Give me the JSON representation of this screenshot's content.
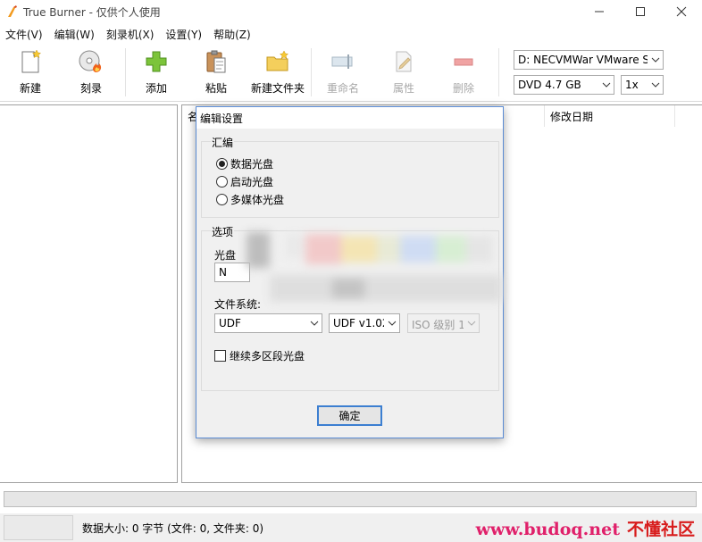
{
  "window": {
    "title": "True Burner - 仅供个人使用"
  },
  "menu": [
    {
      "label": "文件(V)"
    },
    {
      "label": "编辑(W)"
    },
    {
      "label": "刻录机(X)"
    },
    {
      "label": "设置(Y)"
    },
    {
      "label": "帮助(Z)"
    }
  ],
  "toolbar": {
    "new_label": "新建",
    "burn_label": "刻录",
    "add_label": "添加",
    "paste_label": "粘贴",
    "new_folder_label": "新建文件夹",
    "rename_label": "重命名",
    "properties_label": "属性",
    "delete_label": "删除"
  },
  "drive": {
    "value": "D: NECVMWar VMware S"
  },
  "disc_type": {
    "value": "DVD 4.7 GB"
  },
  "speed": {
    "value": "1x"
  },
  "file_list": {
    "columns": [
      "名",
      "修改日期"
    ]
  },
  "dialog": {
    "title": "编辑设置",
    "compile_group": "汇编",
    "options": [
      {
        "label": "数据光盘",
        "selected": true
      },
      {
        "label": "启动光盘",
        "selected": false
      },
      {
        "label": "多媒体光盘",
        "selected": false
      }
    ],
    "options_group": "选项",
    "disc_label_caption": "光盘",
    "disc_label_value": "N",
    "fs_label": "文件系统:",
    "fs_value": "UDF",
    "udf_version": "UDF v1.02",
    "iso_level": "ISO 级别 1",
    "multisession_label": "继续多区段光盘",
    "multisession_checked": false,
    "ok_label": "确定"
  },
  "status": {
    "text": "数据大小: 0 字节 (文件: 0, 文件夹: 0)",
    "watermark": "www.budoq.net",
    "watermark2": "不懂社区"
  },
  "colors": {
    "accent": "#3c7fd1",
    "watermark": "#e0206a"
  }
}
